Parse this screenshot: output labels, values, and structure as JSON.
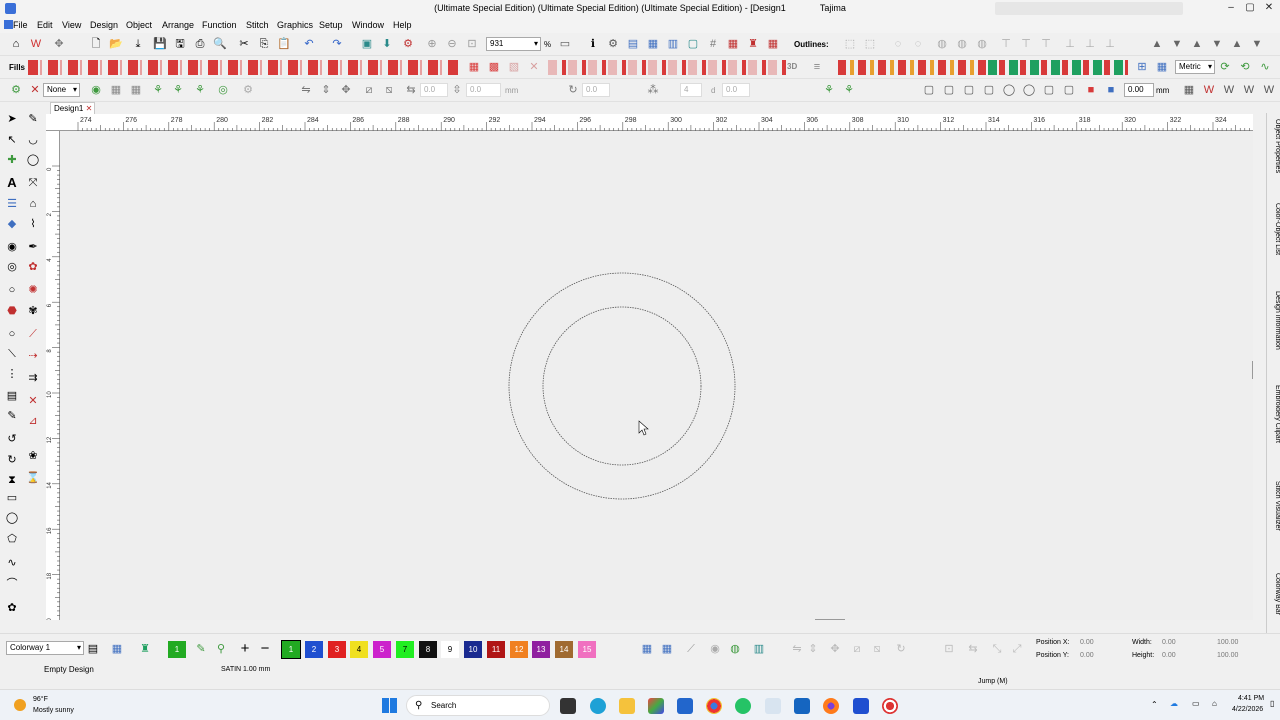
{
  "window": {
    "title": "(Ultimate Special Edition) (Ultimate Special Edition) (Ultimate Special Edition) - [Design1",
    "brand": "Tajima",
    "controls": [
      "–",
      "▢",
      "✕"
    ]
  },
  "menu": [
    "File",
    "Edit",
    "View",
    "Design",
    "Object",
    "Arrange",
    "Function",
    "Stitch",
    "Graphics",
    "Setup",
    "Window",
    "Help"
  ],
  "toolbar1": {
    "zoom_value": "931",
    "zoom_unit": "%",
    "outlines_label": "Outlines:"
  },
  "toolbar2": {
    "fills_label": "Fills",
    "units_value": "Metric"
  },
  "toolbar3": {
    "line_type": "None",
    "field_a": "0.0",
    "field_b": "mm",
    "field_c": "0.0",
    "field_d": "4",
    "field_e": "0.0",
    "field_f": "0.00",
    "field_f_unit": "mm"
  },
  "document": {
    "tab_label": "Design1",
    "close": "✕"
  },
  "ruler": {
    "h_ticks": [
      "274",
      "276",
      "278",
      "280",
      "282",
      "284",
      "286",
      "288",
      "290",
      "292",
      "294",
      "296",
      "298",
      "300",
      "302",
      "304",
      "306",
      "308",
      "310",
      "312",
      "314",
      "316",
      "318",
      "320",
      "322",
      "324"
    ],
    "v_ticks": [
      "0",
      "2",
      "4",
      "6",
      "8",
      "10",
      "12",
      "14",
      "16",
      "18",
      "20"
    ]
  },
  "right_dock": [
    "Object Properties",
    "Color-Object List",
    "Design Information",
    "Embroidery Clipart",
    "Stitch Visualizer",
    "Colorway Bar"
  ],
  "bottom": {
    "colorway": "Colorway 1",
    "swatches": [
      {
        "num": "1",
        "color": "#22aa22"
      },
      {
        "num": "2",
        "color": "#1f4fd0"
      },
      {
        "num": "3",
        "color": "#e02020"
      },
      {
        "num": "4",
        "color": "#f0e020"
      },
      {
        "num": "5",
        "color": "#cc22cc"
      },
      {
        "num": "7",
        "color": "#22ee22"
      },
      {
        "num": "8",
        "color": "#111111"
      },
      {
        "num": "9",
        "color": "#ffffff"
      },
      {
        "num": "10",
        "color": "#1a2a90"
      },
      {
        "num": "11",
        "color": "#b01515"
      },
      {
        "num": "12",
        "color": "#f08020"
      },
      {
        "num": "13",
        "color": "#9020a0"
      },
      {
        "num": "14",
        "color": "#a06a30"
      },
      {
        "num": "15",
        "color": "#f070c0"
      }
    ],
    "position_x_label": "Position X:",
    "position_x": "0.00",
    "position_y_label": "Position Y:",
    "position_y": "0.00",
    "width_label": "Width:",
    "width": "0.00",
    "height_label": "Height:",
    "height": "0.00",
    "scale_w": "100.00",
    "scale_h": "100.00"
  },
  "status": {
    "left": "Empty Design",
    "stitch": "SATIN  1.00 mm",
    "right": "Jump (M)"
  },
  "taskbar": {
    "weather_temp": "96°F",
    "weather_desc": "Mostly sunny",
    "search": "Search",
    "time": "4:41 PM",
    "date": "4/22/2026"
  }
}
